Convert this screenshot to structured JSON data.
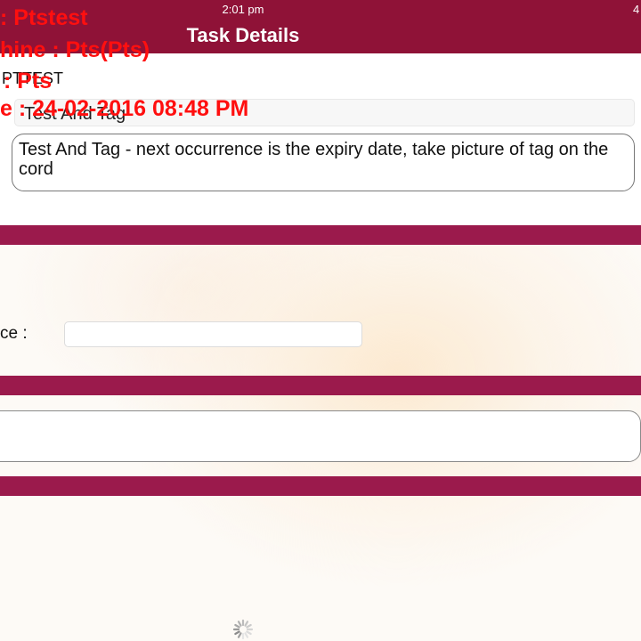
{
  "status_bar": {
    "time": "2:01 pm",
    "right_fragment": "4"
  },
  "header": {
    "title": "Task Details"
  },
  "task": {
    "code": "PTTEST",
    "name": "Test And Tag",
    "description": "Test And Tag - next occurrence is the expiry date, take picture of tag on the cord"
  },
  "reference": {
    "label_fragment": "ce :"
  },
  "overlay": {
    "line1": ": Ptstest",
    "line2": "hine : Pts(Pts)",
    "line3": ": Pts",
    "line4": "e : 24-02-2016 08:48 PM"
  },
  "colors": {
    "header_bg": "#8f1237",
    "section_bar": "#9b1a4c",
    "overlay_text": "#ff0f0f"
  },
  "icons": {
    "loading": "spinner-icon"
  }
}
